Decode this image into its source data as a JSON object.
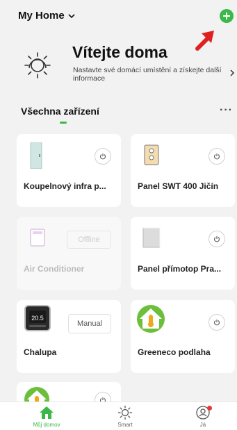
{
  "header": {
    "home_name": "My Home"
  },
  "welcome": {
    "title": "Vítejte doma",
    "subtitle": "Nastavte své domácí umístění a získejte další informace"
  },
  "section": {
    "title": "Všechna zařízení",
    "more": "···"
  },
  "devices": [
    {
      "name": "Koupelnový infra p...",
      "status": ""
    },
    {
      "name": "Panel SWT 400 Jičín",
      "status": ""
    },
    {
      "name": "Air Conditioner",
      "status": "Offline"
    },
    {
      "name": "Panel přímotop Pra...",
      "status": ""
    },
    {
      "name": "Chalupa",
      "mode": "Manual",
      "display": "20.5"
    },
    {
      "name": "Greeneco podlaha",
      "status": ""
    }
  ],
  "tabbar": {
    "tabs": [
      {
        "label": "Můj domov"
      },
      {
        "label": "Smart"
      },
      {
        "label": "Já"
      }
    ]
  },
  "colors": {
    "accent": "#3cb84a",
    "annotation": "#e02020"
  }
}
